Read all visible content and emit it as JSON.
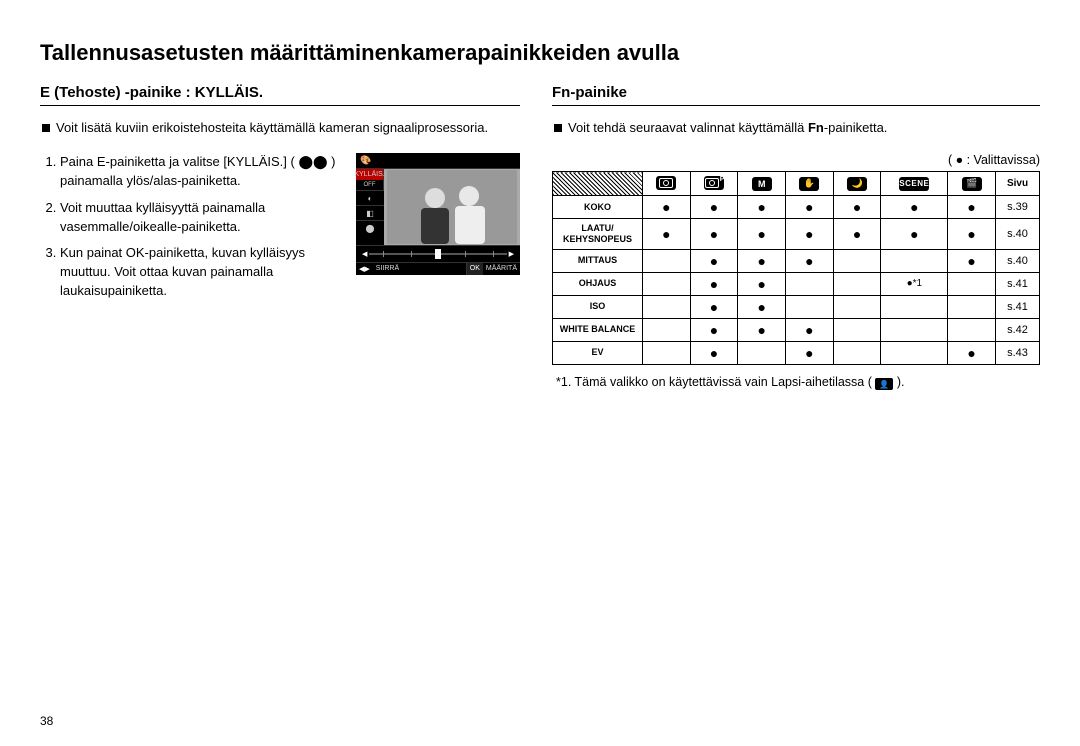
{
  "page_title": "Tallennusasetusten määrittäminenkamerapainikkeiden avulla",
  "page_number": "38",
  "left": {
    "section_title": "E (Tehoste) -painike : KYLLÄIS.",
    "intro": "Voit lisätä kuviin erikoistehosteita käyttämällä kameran signaaliprosessoria.",
    "steps": [
      "Paina E-painiketta ja valitse [KYLLÄIS.] ( ⬤⬤ ) painamalla ylös/alas-painiketta.",
      "Voit muuttaa kylläisyyttä painamalla vasemmalle/oikealle-painiketta.",
      "Kun painat OK-painiketta, kuvan kylläisyys muuttuu. Voit ottaa kuvan painamalla laukaisupainiketta."
    ],
    "lcd": {
      "title": "KYLLÄIS.",
      "off": "OFF",
      "footer_left_btn": "◀▶",
      "footer_left": "SIIRRÄ",
      "footer_right_btn": "OK",
      "footer_right": "MÄÄRITÄ"
    }
  },
  "right": {
    "section_title": "Fn-painike",
    "intro_pre": "Voit tehdä seuraavat valinnat käyttämällä ",
    "intro_bold": "Fn",
    "intro_post": "-painiketta.",
    "legend": "(  ●  : Valittavissa)",
    "columns": {
      "modes": [
        "auto-icon",
        "program-icon",
        "M",
        "dis-icon",
        "night-icon",
        "SCENE",
        "movie-icon"
      ],
      "page_header": "Sivu"
    },
    "rows": [
      {
        "name": "KOKO",
        "cells": [
          "●",
          "●",
          "●",
          "●",
          "●",
          "●",
          "●"
        ],
        "page": "s.39"
      },
      {
        "name": "LAATU/\nKEHYSNOPEUS",
        "cells": [
          "●",
          "●",
          "●",
          "●",
          "●",
          "●",
          "●"
        ],
        "page": "s.40"
      },
      {
        "name": "MITTAUS",
        "cells": [
          "",
          "●",
          "●",
          "●",
          "",
          "",
          "●"
        ],
        "page": "s.40"
      },
      {
        "name": "OHJAUS",
        "cells": [
          "",
          "●",
          "●",
          "",
          "",
          "●*1",
          ""
        ],
        "page": "s.41"
      },
      {
        "name": "ISO",
        "cells": [
          "",
          "●",
          "●",
          "",
          "",
          "",
          ""
        ],
        "page": "s.41"
      },
      {
        "name": "WHITE BALANCE",
        "cells": [
          "",
          "●",
          "●",
          "●",
          "",
          "",
          ""
        ],
        "page": "s.42"
      },
      {
        "name": "EV",
        "cells": [
          "",
          "●",
          "",
          "●",
          "",
          "",
          "●"
        ],
        "page": "s.43"
      }
    ],
    "footnote_pre": "*1. Tämä valikko on käytettävissä vain Lapsi-aihetilassa ( ",
    "footnote_post": " )."
  }
}
